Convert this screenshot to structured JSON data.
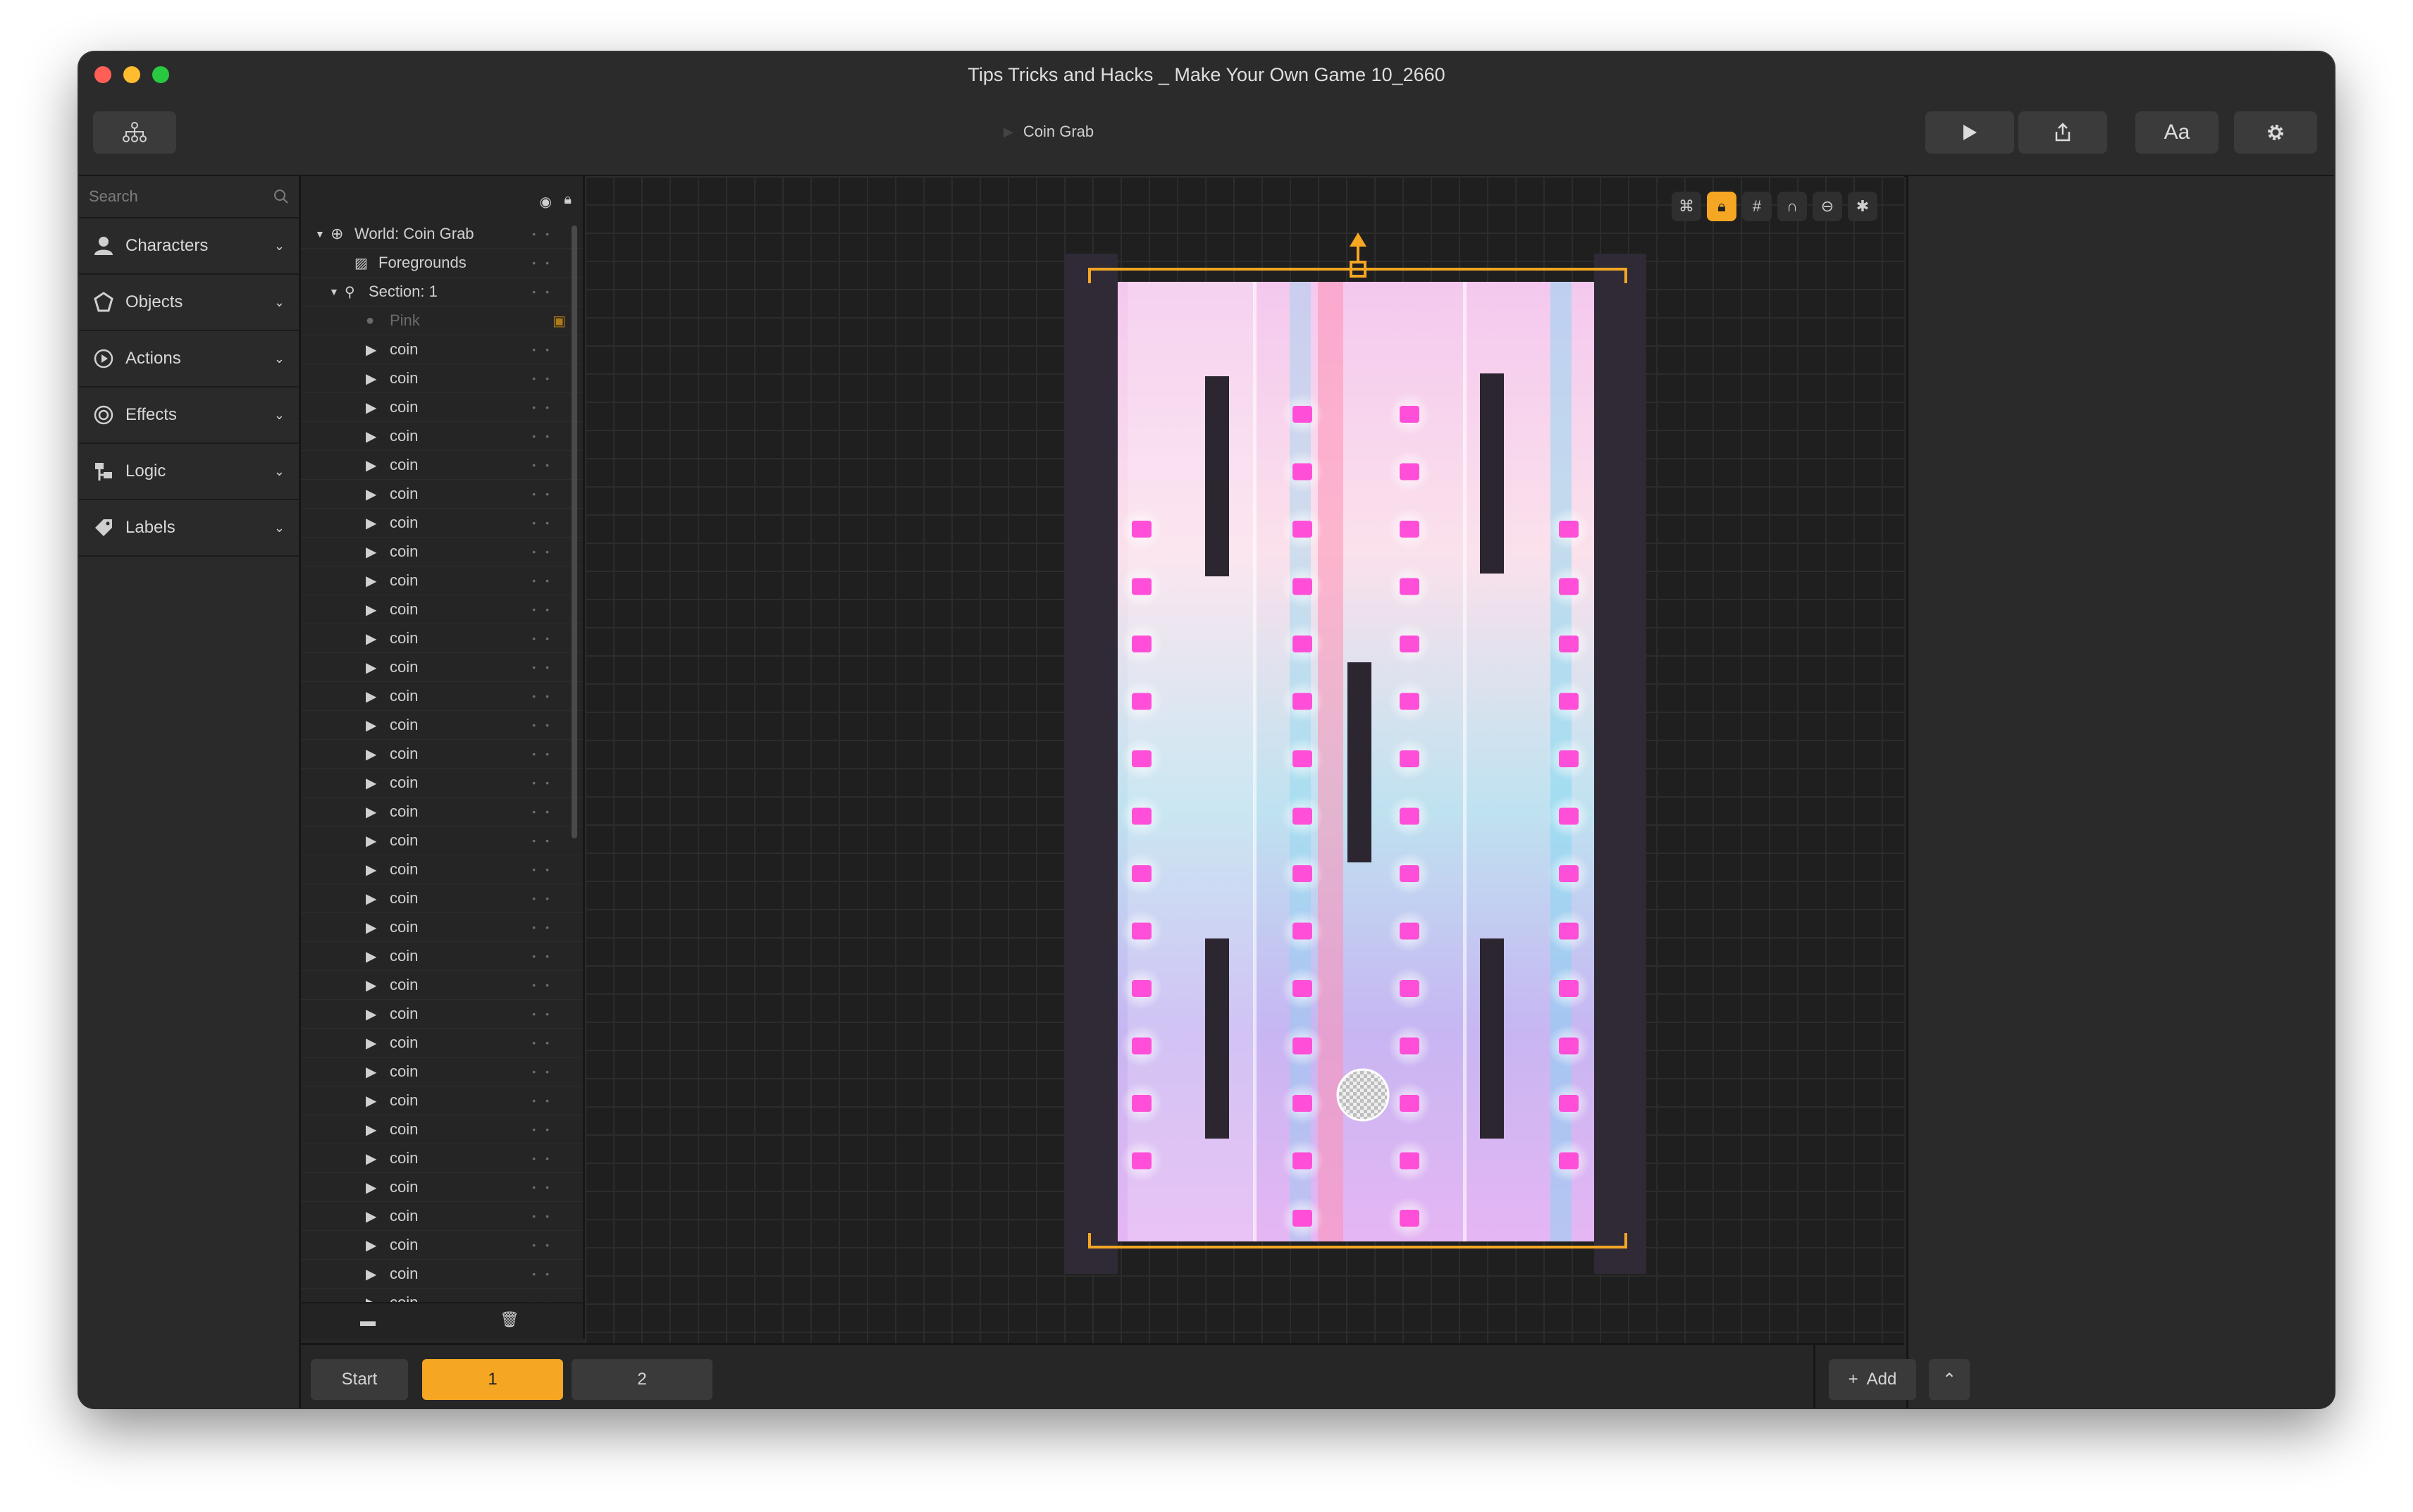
{
  "window": {
    "title": "Tips Tricks and Hacks _ Make Your Own Game 10_2660"
  },
  "toolbar": {
    "hierarchy_icon": "hierarchy-icon",
    "breadcrumb": "Coin Grab",
    "play_icon": "play-icon",
    "share_icon": "share-icon",
    "font_label": "Aa",
    "settings_icon": "gear-icon"
  },
  "library": {
    "search_placeholder": "Search",
    "categories": [
      {
        "label": "Characters",
        "icon": "person-icon"
      },
      {
        "label": "Objects",
        "icon": "objects-icon"
      },
      {
        "label": "Actions",
        "icon": "play-circle-icon"
      },
      {
        "label": "Effects",
        "icon": "swirl-icon"
      },
      {
        "label": "Logic",
        "icon": "logic-icon"
      },
      {
        "label": "Labels",
        "icon": "tag-icon"
      }
    ]
  },
  "tree": {
    "world": "World: Coin Grab",
    "foregrounds": "Foregrounds",
    "section": "Section: 1",
    "pink": "Pink",
    "coin_label": "coin",
    "coin_count": 34
  },
  "bottombar": {
    "start": "Start",
    "tab1": "1",
    "tab2": "2",
    "add": "Add"
  },
  "colors": {
    "accent": "#f5a623",
    "coin": "#ff4fd8"
  }
}
